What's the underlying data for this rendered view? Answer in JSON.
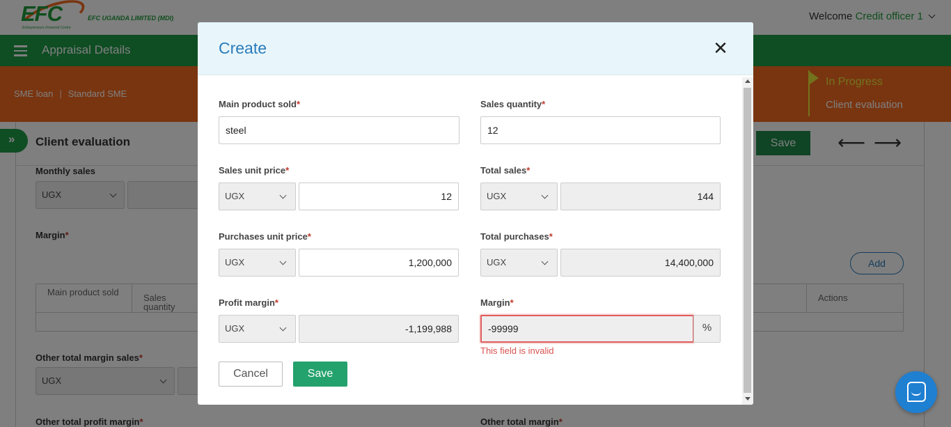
{
  "header": {
    "logo_text": "EFC",
    "logo_tagline": "Entrepreneurs Financial Centre",
    "company_name": "EFC UGANDA LIMITED (MDI)",
    "welcome_prefix": "Welcome",
    "user_name": "Credit officer 1"
  },
  "navbar": {
    "title": "Appraisal Details"
  },
  "breadcrumb": {
    "product": "SME loan",
    "separator": "|",
    "type": "Standard SME"
  },
  "status": {
    "title": "In Progress",
    "stage": "Client evaluation"
  },
  "page": {
    "section_title": "Client evaluation",
    "save_label": "Save",
    "monthly_sales_label": "Monthly sales",
    "currency": "UGX",
    "margin_label": "Margin",
    "add_label": "Add",
    "table_headers": [
      "Main product sold",
      "Sales quantity",
      "Actions"
    ],
    "other_total_margin_sales_label": "Other total margin sales",
    "other_total_profit_margin_label": "Other total profit margin",
    "other_total_margin_label": "Other total margin"
  },
  "modal": {
    "title": "Create",
    "close_symbol": "✕",
    "required_mark": "*",
    "fields": {
      "main_product_sold": {
        "label": "Main product sold",
        "value": "steel"
      },
      "sales_quantity": {
        "label": "Sales quantity",
        "value": "12"
      },
      "sales_unit_price": {
        "label": "Sales unit price",
        "currency": "UGX",
        "value": "12"
      },
      "total_sales": {
        "label": "Total sales",
        "currency": "UGX",
        "value": "144"
      },
      "purchases_unit_price": {
        "label": "Purchases unit price",
        "currency": "UGX",
        "value": "1,200,000"
      },
      "total_purchases": {
        "label": "Total purchases",
        "currency": "UGX",
        "value": "14,400,000"
      },
      "profit_margin": {
        "label": "Profit margin",
        "currency": "UGX",
        "value": "-1,199,988"
      },
      "margin": {
        "label": "Margin",
        "value": "-99999",
        "unit": "%",
        "error": "This field is invalid"
      }
    },
    "cancel_label": "Cancel",
    "save_label": "Save"
  },
  "colors": {
    "brand_green": "#1e9b47",
    "brand_orange": "#f26a21",
    "modal_title_blue": "#2b7bb9",
    "save_green": "#23a26d",
    "error_red": "#d9534f"
  },
  "icons": [
    "hamburger-icon",
    "chevron-down-icon",
    "double-chevron-right-icon",
    "arrow-left-icon",
    "arrow-right-icon",
    "close-icon",
    "chat-icon",
    "flag-icon"
  ]
}
